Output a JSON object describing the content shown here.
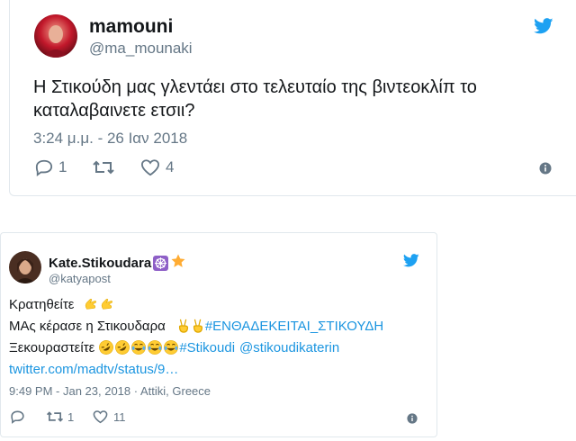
{
  "tweet1": {
    "display_name": "mamouni",
    "handle": "@ma_mounaki",
    "text_line1": "Η Στικούδη μας γλεντάει στο τελευταίο της βιντεοκλίπ το",
    "text_line2": "καταλαβαινετε ετσιι?",
    "timestamp": "3:24 μ.μ. - 26 Ιαν 2018",
    "reply_count": "1",
    "like_count": "4",
    "avatar_color": "#c2182b"
  },
  "tweet2": {
    "display_name": "Kate.Stikoudara",
    "handle": "@katyapost",
    "line1_text": "Κρατηθείτε",
    "line2_text": "ΜΑς κέρασε η Στικουδαρα",
    "line2_hashtag": "#ΕΝΘΑΔΕΚΕΙΤΑΙ_ΣΤΙΚΟΥΔΗ",
    "line3_text": "Ξεκουραστείτε",
    "line3_hashtag": "#Stikoudi",
    "line3_mention": "@stikoudikaterin",
    "link_text": "twitter.com/madtv/status/9…",
    "timestamp": "9:49 PM - Jan 23, 2018 · Attiki, Greece",
    "retweet_count": "1",
    "like_count": "11"
  },
  "colors": {
    "twitter_blue": "#1da1f2",
    "link_blue": "#1b95e0",
    "muted_gray": "#657786",
    "border": "#e1e8ed",
    "emoji_yellow": "#ffcc33"
  },
  "icons": [
    "twitter-bird-icon",
    "reply-icon",
    "retweet-icon",
    "like-heart-icon",
    "info-icon",
    "dharma-wheel-icon",
    "star-icon",
    "raised-hand-emoji",
    "victory-hand-emoji",
    "rofl-emoji",
    "tears-of-joy-emoji"
  ]
}
